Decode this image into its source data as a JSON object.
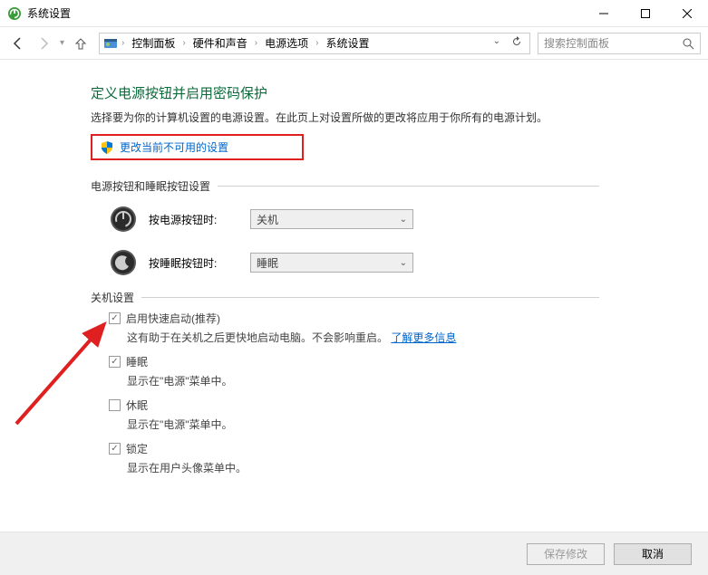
{
  "window": {
    "title": "系统设置"
  },
  "nav": {
    "breadcrumbs": [
      "控制面板",
      "硬件和声音",
      "电源选项",
      "系统设置"
    ],
    "search_placeholder": "搜索控制面板"
  },
  "page": {
    "heading": "定义电源按钮并启用密码保护",
    "description": "选择要为你的计算机设置的电源设置。在此页上对设置所做的更改将应用于你所有的电源计划。",
    "admin_link": "更改当前不可用的设置",
    "section_buttons_label": "电源按钮和睡眠按钮设置",
    "power_button": {
      "label": "按电源按钮时:",
      "value": "关机"
    },
    "sleep_button": {
      "label": "按睡眠按钮时:",
      "value": "睡眠"
    },
    "section_shutdown_label": "关机设置",
    "shutdown_options": {
      "fast_startup": {
        "label": "启用快速启动(推荐)",
        "desc_a": "这有助于在关机之后更快地启动电脑。不会影响重启。",
        "more": "了解更多信息"
      },
      "sleep": {
        "label": "睡眠",
        "desc": "显示在\"电源\"菜单中。"
      },
      "hibernate": {
        "label": "休眠",
        "desc": "显示在\"电源\"菜单中。"
      },
      "lock": {
        "label": "锁定",
        "desc": "显示在用户头像菜单中。"
      }
    }
  },
  "footer": {
    "save": "保存修改",
    "cancel": "取消"
  }
}
